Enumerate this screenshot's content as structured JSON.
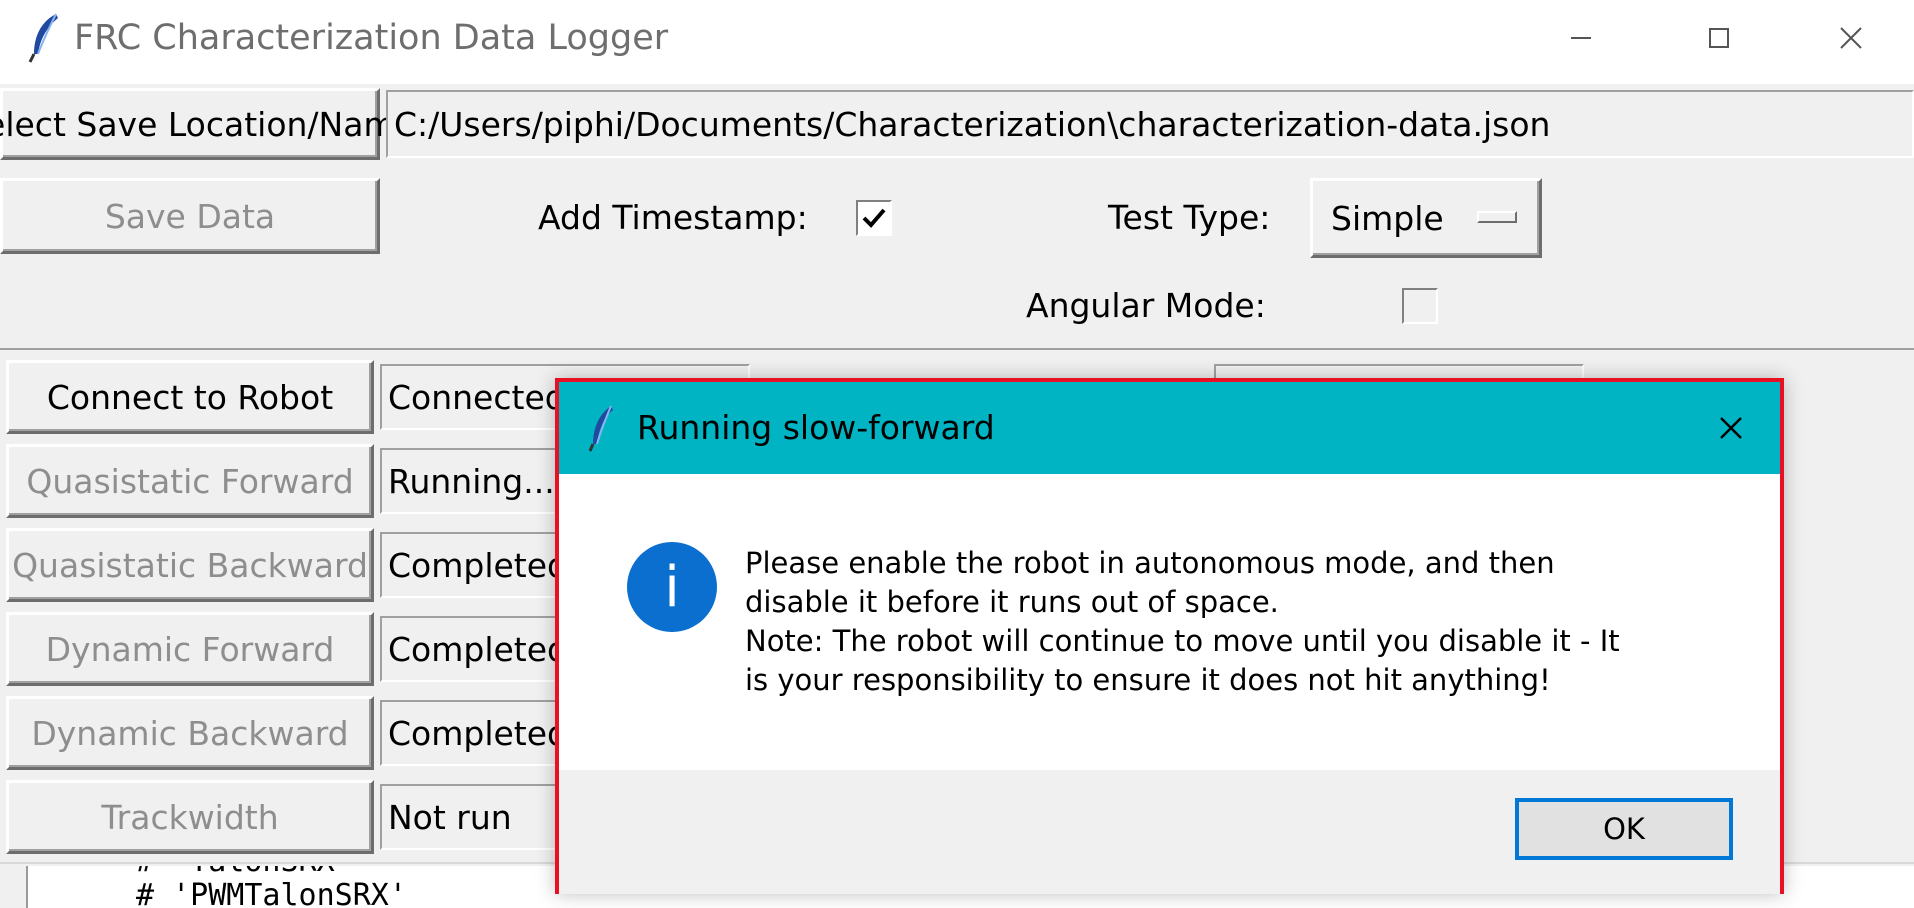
{
  "window": {
    "title": "FRC Characterization Data Logger",
    "app_icon": "feather-icon",
    "controls": {
      "minimize": "minimize-icon",
      "maximize": "maximize-icon",
      "close": "close-icon"
    }
  },
  "top_form": {
    "select_save_label": "Select Save Location/Name",
    "save_path": "C:/Users/piphi/Documents/Characterization\\characterization-data.json",
    "save_data_label": "Save Data",
    "add_timestamp_label": "Add Timestamp:",
    "add_timestamp_checked": true,
    "test_type_label": "Test Type:",
    "test_type_value": "Simple",
    "angular_mode_label": "Angular Mode:",
    "angular_mode_checked": false
  },
  "tests": [
    {
      "label": "Connect to Robot",
      "status": "Connected",
      "enabled": true
    },
    {
      "label": "Quasistatic Forward",
      "status": "Running...",
      "enabled": false
    },
    {
      "label": "Quasistatic Backward",
      "status": "Completed",
      "enabled": false
    },
    {
      "label": "Dynamic Forward",
      "status": "Completed",
      "enabled": false
    },
    {
      "label": "Dynamic Backward",
      "status": "Completed",
      "enabled": false
    },
    {
      "label": "Trackwidth",
      "status": "Not run",
      "enabled": false
    }
  ],
  "text_area": {
    "line1": "#  'TalonSRX'",
    "line2": "#  'PWMTalonSRX'"
  },
  "dialog": {
    "title": "Running slow-forward",
    "icon": "info-icon",
    "icon_glyph": "i",
    "message_lines": [
      "Please enable the robot in autonomous mode, and then",
      "disable it before it runs out of space.",
      "Note: The robot will continue to move until you disable it - It",
      "is your responsibility to ensure it does not hit anything!"
    ],
    "ok_label": "OK"
  },
  "colors": {
    "dialog_title_bg": "#00b4c4",
    "dialog_border": "#e81123",
    "info_icon": "#0a6fce",
    "ok_focus": "#0078d7"
  }
}
